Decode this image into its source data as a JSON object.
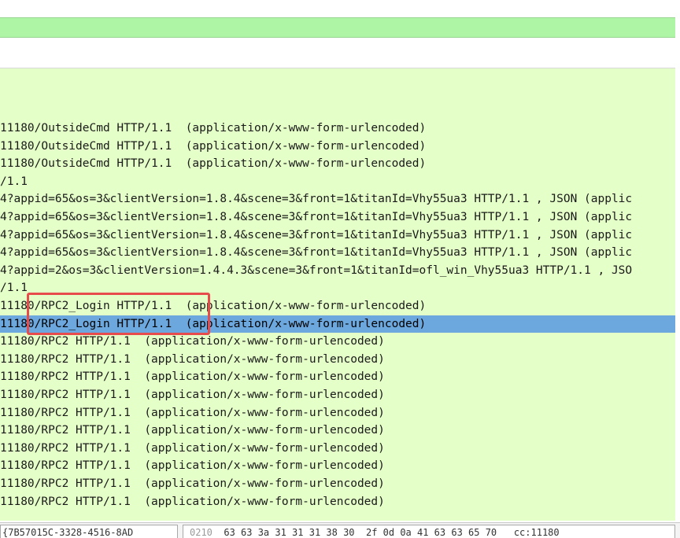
{
  "packet_list": {
    "rows": [
      {
        "text": "11180/OutsideCmd HTTP/1.1  (application/x-www-form-urlencoded)",
        "selected": false
      },
      {
        "text": "11180/OutsideCmd HTTP/1.1  (application/x-www-form-urlencoded)",
        "selected": false
      },
      {
        "text": "11180/OutsideCmd HTTP/1.1  (application/x-www-form-urlencoded)",
        "selected": false
      },
      {
        "text": "/1.1",
        "selected": false
      },
      {
        "text": "4?appid=65&os=3&clientVersion=1.8.4&scene=3&front=1&titanId=Vhy55ua3 HTTP/1.1 , JSON (applic",
        "selected": false
      },
      {
        "text": "4?appid=65&os=3&clientVersion=1.8.4&scene=3&front=1&titanId=Vhy55ua3 HTTP/1.1 , JSON (applic",
        "selected": false
      },
      {
        "text": "4?appid=65&os=3&clientVersion=1.8.4&scene=3&front=1&titanId=Vhy55ua3 HTTP/1.1 , JSON (applic",
        "selected": false
      },
      {
        "text": "4?appid=65&os=3&clientVersion=1.8.4&scene=3&front=1&titanId=Vhy55ua3 HTTP/1.1 , JSON (applic",
        "selected": false
      },
      {
        "text": "4?appid=2&os=3&clientVersion=1.4.4.3&scene=3&front=1&titanId=ofl_win_Vhy55ua3 HTTP/1.1 , JSO",
        "selected": false
      },
      {
        "text": "/1.1",
        "selected": false
      },
      {
        "text": "11180/RPC2_Login HTTP/1.1  (application/x-www-form-urlencoded)",
        "selected": false
      },
      {
        "text": "11180/RPC2_Login HTTP/1.1  (application/x-www-form-urlencoded)",
        "selected": true
      },
      {
        "text": "11180/RPC2 HTTP/1.1  (application/x-www-form-urlencoded)",
        "selected": false
      },
      {
        "text": "11180/RPC2 HTTP/1.1  (application/x-www-form-urlencoded)",
        "selected": false
      },
      {
        "text": "11180/RPC2 HTTP/1.1  (application/x-www-form-urlencoded)",
        "selected": false
      },
      {
        "text": "11180/RPC2 HTTP/1.1  (application/x-www-form-urlencoded)",
        "selected": false
      },
      {
        "text": "11180/RPC2 HTTP/1.1  (application/x-www-form-urlencoded)",
        "selected": false
      },
      {
        "text": "11180/RPC2 HTTP/1.1  (application/x-www-form-urlencoded)",
        "selected": false
      },
      {
        "text": "11180/RPC2 HTTP/1.1  (application/x-www-form-urlencoded)",
        "selected": false
      },
      {
        "text": "11180/RPC2 HTTP/1.1  (application/x-www-form-urlencoded)",
        "selected": false
      },
      {
        "text": "11180/RPC2 HTTP/1.1  (application/x-www-form-urlencoded)",
        "selected": false
      },
      {
        "text": "11180/RPC2 HTTP/1.1  (application/x-www-form-urlencoded)",
        "selected": false
      }
    ]
  },
  "bytes_pane": {
    "left_text": "{7B57015C-3328-4516-8AD",
    "offset": "0210",
    "hex_text": "63 63 3a 31 31 31 38 30  2f 0d 0a 41 63 63 65 70",
    "ascii_text": "cc:11180"
  },
  "colors": {
    "filter_bar": "#aff5a6",
    "packet_list_bg": "#e4ffc7",
    "selected_row": "#6ca8dd",
    "highlight_box": "#e84b4b"
  }
}
